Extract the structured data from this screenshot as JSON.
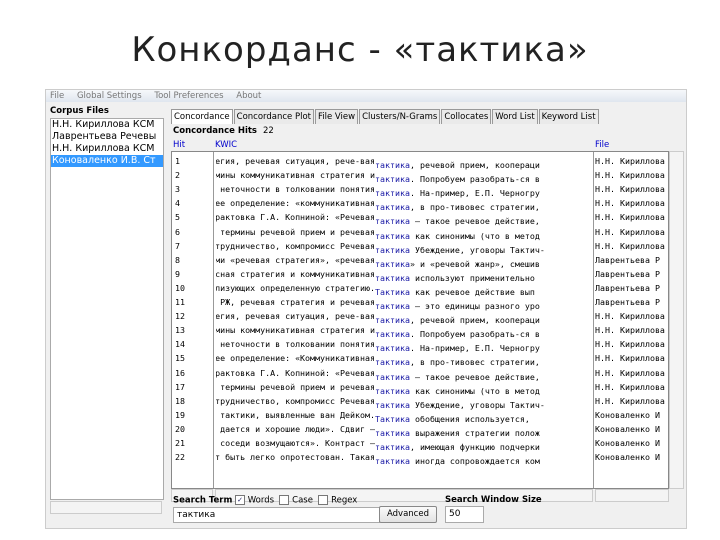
{
  "slide_title": "Конкорданс - «тактика»",
  "menu": [
    "File",
    "Global Settings",
    "Tool Preferences",
    "About"
  ],
  "corpus": {
    "header": "Corpus Files",
    "files": [
      "Н.Н. Кириллова КСМ",
      "Лаврентьева Речевы",
      "Н.Н. Кириллова КСМ",
      "Коноваленко И.В. Ст"
    ],
    "selected_index": 3
  },
  "tabs": [
    "Concordance",
    "Concordance Plot",
    "File View",
    "Clusters/N-Grams",
    "Collocates",
    "Word List",
    "Keyword List"
  ],
  "active_tab": "Concordance",
  "hits_label": "Concordance Hits",
  "hits_count": "22",
  "columns": {
    "hit": "Hit",
    "kwic": "KWIC",
    "file": "File"
  },
  "rows": [
    {
      "n": "1",
      "l": "егия, речевая ситуация, рече-вая ",
      "k": "тактика",
      "r": ", речевой прием, коопераци",
      "f": "Н.Н. Кириллова"
    },
    {
      "n": "2",
      "l": "мины коммуникативная стратегия и ",
      "k": "тактика",
      "r": ". Попробуем разобрать-ся в",
      "f": "Н.Н. Кириллова"
    },
    {
      "n": "3",
      "l": " неточности в толковании понятия ",
      "k": "тактика",
      "r": ". На-пример, Е.П. Черногру",
      "f": "Н.Н. Кириллова"
    },
    {
      "n": "4",
      "l": "ее определение: «коммуникативная ",
      "k": "тактика",
      "r": ", в про-тивовес стратегии,",
      "f": "Н.Н. Кириллова"
    },
    {
      "n": "5",
      "l": "рактовка Г.А. Копниной: «Речевая ",
      "k": "тактика",
      "r": " – такое речевое действие,",
      "f": "Н.Н. Кириллова"
    },
    {
      "n": "6",
      "l": " термины речевой прием и речевая ",
      "k": "тактика",
      "r": " как синонимы (что в метод",
      "f": "Н.Н. Кириллова"
    },
    {
      "n": "7",
      "l": "трудничество, компромисс Речевая ",
      "k": "тактика",
      "r": " Убеждение, уговоры Тактич-",
      "f": "Н.Н. Кириллова"
    },
    {
      "n": "8",
      "l": "ми «речевая стратегия», «речевая ",
      "k": "тактика",
      "r": "» и «речевой жанр», смешив",
      "f": "Лаврентьева Р"
    },
    {
      "n": "9",
      "l": "сная стратегия и коммуникативная ",
      "k": "тактика",
      "r": " используют применительно ",
      "f": "Лаврентьева Р"
    },
    {
      "n": "10",
      "l": "лизующих определенную стратегию. ",
      "k": "Тактика",
      "r": " как речевое действие вып",
      "f": "Лаврентьева Р"
    },
    {
      "n": "11",
      "l": " РЖ, речевая стратегия и речевая ",
      "k": "тактика",
      "r": " – это единицы разного уро",
      "f": "Лаврентьева Р"
    },
    {
      "n": "12",
      "l": "егия, речевая ситуация, рече-вая ",
      "k": "тактика",
      "r": ", речевой прием, коопераци",
      "f": "Н.Н. Кириллова"
    },
    {
      "n": "13",
      "l": "мины коммуникативная стратегия и ",
      "k": "тактика",
      "r": ". Попробуем разобрать-ся в",
      "f": "Н.Н. Кириллова"
    },
    {
      "n": "14",
      "l": " неточности в толковании понятия ",
      "k": "тактика",
      "r": ". На-пример, Е.П. Черногру",
      "f": "Н.Н. Кириллова"
    },
    {
      "n": "15",
      "l": "ее определение: «Коммуникативная ",
      "k": "тактика",
      "r": ", в про-тивовес стратегии,",
      "f": "Н.Н. Кириллова"
    },
    {
      "n": "16",
      "l": "рактовка Г.А. Копниной: «Речевая ",
      "k": "тактика",
      "r": " – такое речевое действие,",
      "f": "Н.Н. Кириллова"
    },
    {
      "n": "17",
      "l": " термины речевой прием и речевая ",
      "k": "тактика",
      "r": " как синонимы (что в метод",
      "f": "Н.Н. Кириллова"
    },
    {
      "n": "18",
      "l": "трудничество, компромисс Речевая ",
      "k": "тактика",
      "r": " Убеждение, уговоры Тактич-",
      "f": "Н.Н. Кириллова"
    },
    {
      "n": "19",
      "l": "тактики, выявленные ван Дейком.  ",
      "k": "Тактика",
      "r": " обобщения используется, ",
      "f": "Коноваленко И"
    },
    {
      "n": "20",
      "l": "дается и хорошие люди».  Сдвиг – ",
      "k": "тактика",
      "r": " выражения стратегии полож",
      "f": "Коноваленко И"
    },
    {
      "n": "21",
      "l": "соседи возмущаются».  Контраст – ",
      "k": "тактика",
      "r": ", имеющая функцию подчерки",
      "f": "Коноваленко И"
    },
    {
      "n": "22",
      "l": "т быть легко опротестован. Такая ",
      "k": "тактика",
      "r": " иногда сопровождается ком",
      "f": "Коноваленко И"
    }
  ],
  "search": {
    "label": "Search Term",
    "words_label": "Words",
    "words": true,
    "case_label": "Case",
    "case": false,
    "regex_label": "Regex",
    "regex": false,
    "value": "тактика",
    "advanced": "Advanced"
  },
  "window_size": {
    "label": "Search Window Size",
    "value": "50"
  }
}
